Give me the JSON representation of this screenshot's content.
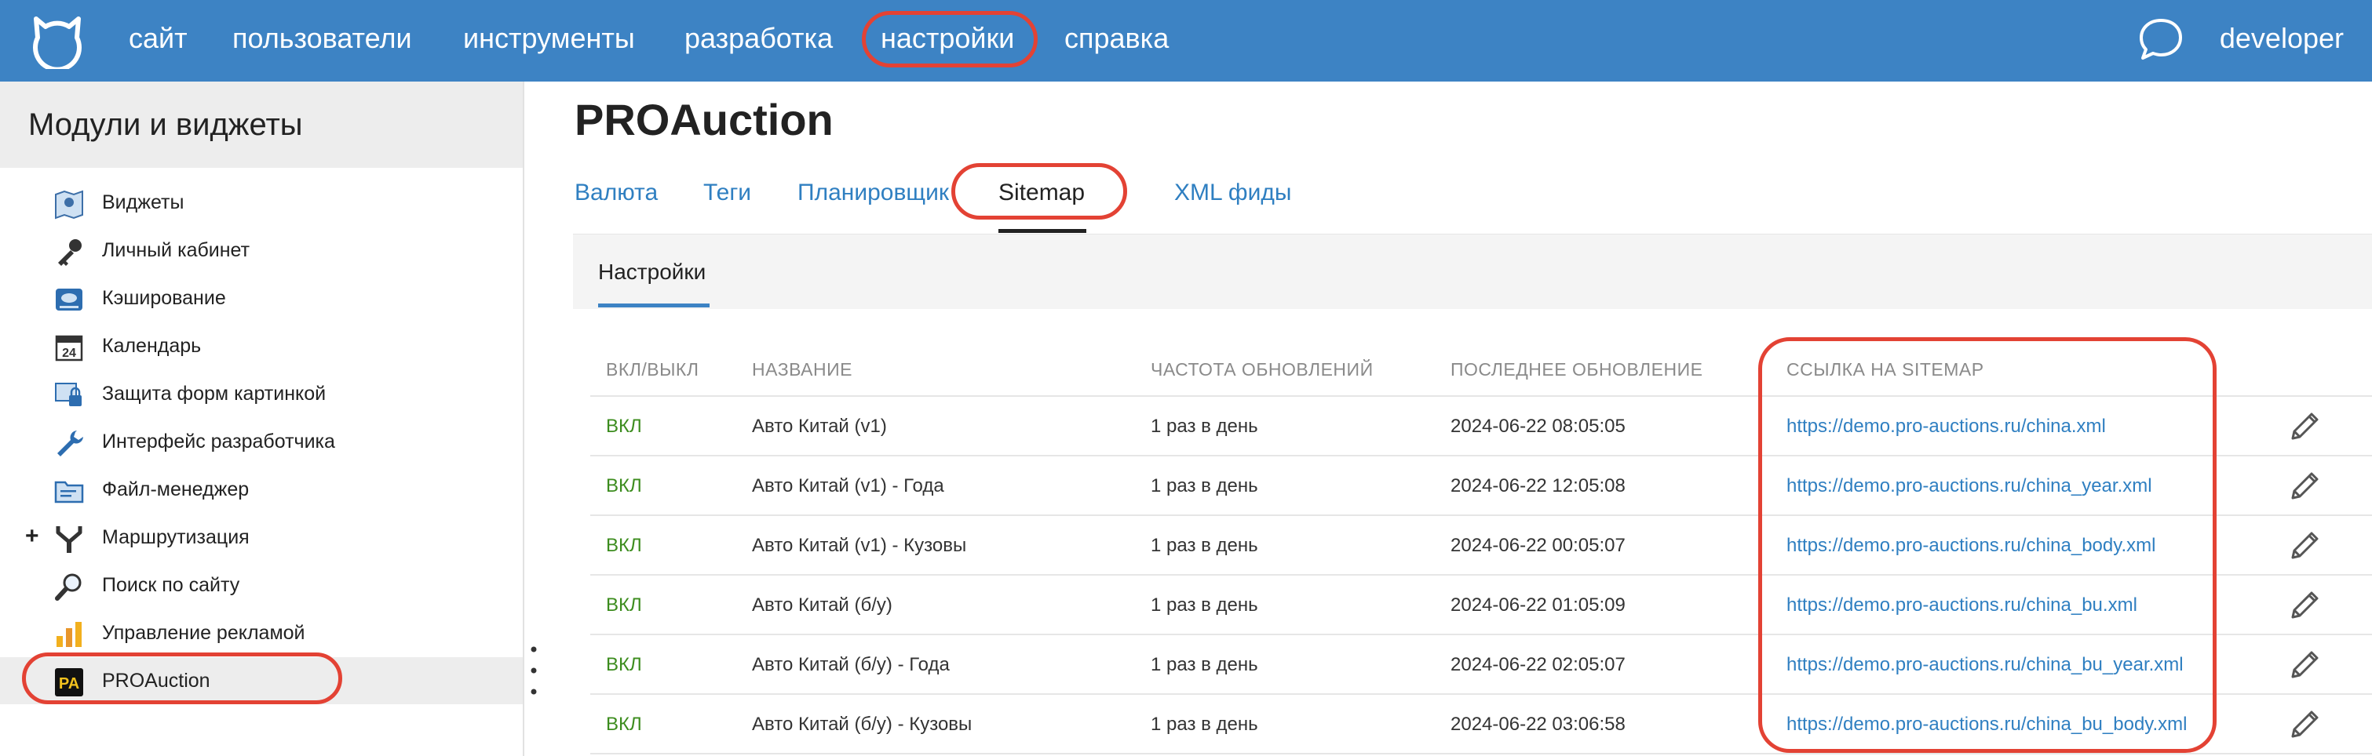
{
  "topbar": {
    "nav": [
      "сайт",
      "пользователи",
      "инструменты",
      "разработка",
      "настройки",
      "справка"
    ],
    "user": "developer",
    "colors": {
      "bar": "#3d83c4",
      "highlight": "#e34234"
    }
  },
  "sidebar": {
    "title": "Модули и виджеты",
    "items": [
      {
        "label": "Виджеты",
        "icon": "widgets-map-icon"
      },
      {
        "label": "Личный кабинет",
        "icon": "key-icon"
      },
      {
        "label": "Кэширование",
        "icon": "cache-disk-icon"
      },
      {
        "label": "Календарь",
        "icon": "calendar-icon",
        "icon_text": "24"
      },
      {
        "label": "Защита форм картинкой",
        "icon": "captcha-icon"
      },
      {
        "label": "Интерфейс разработчика",
        "icon": "wrench-icon"
      },
      {
        "label": "Файл-менеджер",
        "icon": "folder-icon"
      },
      {
        "label": "Маршрутизация",
        "icon": "routing-fork-icon",
        "expand": "+"
      },
      {
        "label": "Поиск по сайту",
        "icon": "magnifier-icon"
      },
      {
        "label": "Управление рекламой",
        "icon": "bar-chart-icon"
      },
      {
        "label": "PROAuction",
        "icon": "pa-logo-icon",
        "icon_text": "PA",
        "active": true
      }
    ]
  },
  "main": {
    "title": "PROAuction",
    "tabs": [
      "Валюта",
      "Теги",
      "Планировщик",
      "Sitemap",
      "XML фиды"
    ],
    "active_tab": "Sitemap",
    "subtab": "Настройки"
  },
  "table": {
    "columns": [
      "ВКЛ/ВЫКЛ",
      "НАЗВАНИЕ",
      "ЧАСТОТА ОБНОВЛЕНИЙ",
      "ПОСЛЕДНЕЕ ОБНОВЛЕНИЕ",
      "ССЫЛКА НА SITEMAP"
    ],
    "rows": [
      {
        "status": "ВКЛ",
        "name": "Авто Китай (v1)",
        "freq": "1 раз в день",
        "updated": "2024-06-22 08:05:05",
        "link": "https://demo.pro-auctions.ru/china.xml"
      },
      {
        "status": "ВКЛ",
        "name": "Авто Китай (v1) - Года",
        "freq": "1 раз в день",
        "updated": "2024-06-22 12:05:08",
        "link": "https://demo.pro-auctions.ru/china_year.xml"
      },
      {
        "status": "ВКЛ",
        "name": "Авто Китай (v1) - Кузовы",
        "freq": "1 раз в день",
        "updated": "2024-06-22 00:05:07",
        "link": "https://demo.pro-auctions.ru/china_body.xml"
      },
      {
        "status": "ВКЛ",
        "name": "Авто Китай (б/у)",
        "freq": "1 раз в день",
        "updated": "2024-06-22 01:05:09",
        "link": "https://demo.pro-auctions.ru/china_bu.xml"
      },
      {
        "status": "ВКЛ",
        "name": "Авто Китай (б/у) - Года",
        "freq": "1 раз в день",
        "updated": "2024-06-22 02:05:07",
        "link": "https://demo.pro-auctions.ru/china_bu_year.xml"
      },
      {
        "status": "ВКЛ",
        "name": "Авто Китай (б/у) - Кузовы",
        "freq": "1 раз в день",
        "updated": "2024-06-22 03:06:58",
        "link": "https://demo.pro-auctions.ru/china_bu_body.xml"
      }
    ]
  }
}
